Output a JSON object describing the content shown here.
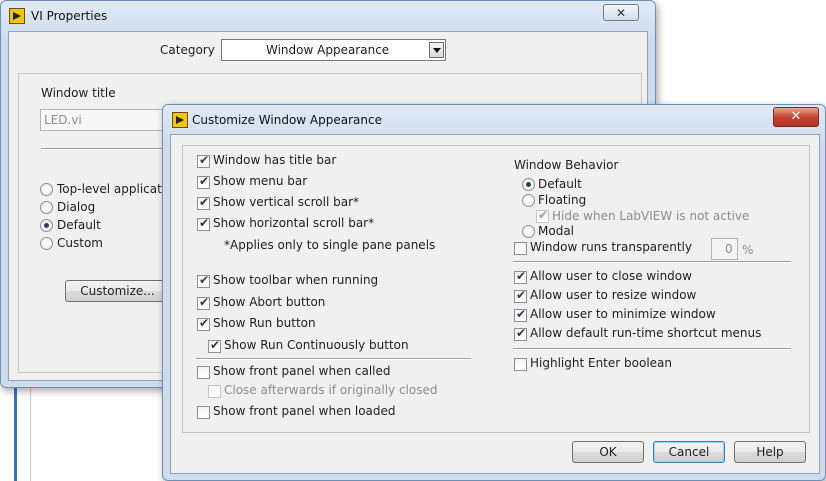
{
  "vi_props": {
    "title": "VI Properties",
    "close_glyph": "✕",
    "category_label": "Category",
    "category_value": "Window Appearance",
    "window_title_label": "Window title",
    "window_title_value": "LED.vi",
    "radios": [
      {
        "label": "Top-level applicatio",
        "checked": false
      },
      {
        "label": "Dialog",
        "checked": false
      },
      {
        "label": "Default",
        "checked": true
      },
      {
        "label": "Custom",
        "checked": false
      }
    ],
    "customize_button": "Customize..."
  },
  "cwa": {
    "title": "Customize Window Appearance",
    "close_glyph": "✕",
    "left": {
      "title_bar": "Window has title bar",
      "menu_bar": "Show menu bar",
      "vscroll": "Show vertical scroll bar*",
      "hscroll": "Show horizontal scroll bar*",
      "note": "*Applies only to single pane panels",
      "toolbar": "Show toolbar when running",
      "abort": "Show Abort button",
      "run": "Show Run button",
      "run_cont": "Show Run Continuously button",
      "front_called": "Show front panel when called",
      "close_after": "Close afterwards if originally closed",
      "front_loaded": "Show front panel when loaded"
    },
    "right": {
      "behavior_label": "Window Behavior",
      "default": "Default",
      "floating": "Floating",
      "hide_lv": "Hide when LabVIEW is not active",
      "modal": "Modal",
      "transparent": "Window runs transparently",
      "transparency_value": "0",
      "percent": "%",
      "allow_close": "Allow user to close window",
      "allow_resize": "Allow user to resize window",
      "allow_minimize": "Allow user to minimize window",
      "allow_shortcuts": "Allow default run-time shortcut menus",
      "highlight_enter": "Highlight Enter boolean"
    },
    "ok_button": "OK",
    "cancel_button": "Cancel",
    "help_button": "Help"
  }
}
